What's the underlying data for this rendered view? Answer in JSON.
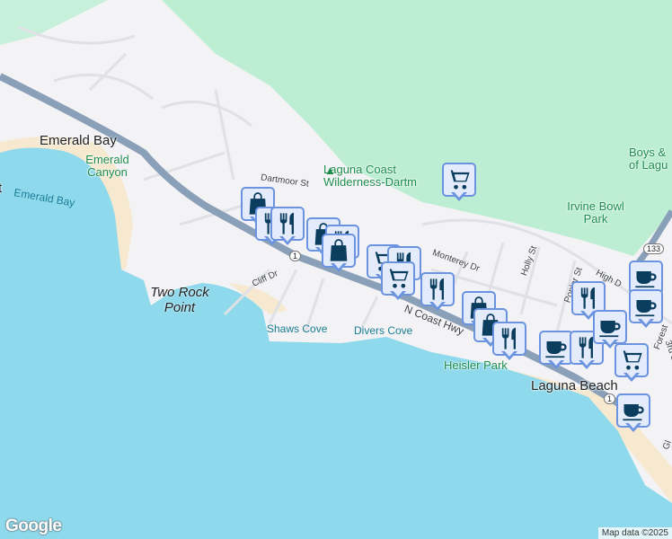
{
  "places": {
    "emerald_bay": "Emerald Bay",
    "emerald_canyon": "Emerald Canyon",
    "emerald_bay_water": "Emerald Bay",
    "two_rock_point": "Two Rock Point",
    "shaws_cove": "Shaws Cove",
    "divers_cove": "Divers Cove",
    "heisler_park": "Heisler Park",
    "laguna_beach": "Laguna Beach",
    "laguna_coast": "Laguna Coast Wilderness-Dartm",
    "irvine_bowl_park": "Irvine Bowl Park",
    "boys_girls": "Boys & of Lagu",
    "left_edge": "t"
  },
  "streets": {
    "dartmoor": "Dartmoor St",
    "cliff": "Cliff Dr",
    "monterey": "Monterey Dr",
    "holly": "Holly St",
    "poplar": "Poplar St",
    "high": "High D",
    "coast_hwy": "N Coast Hwy",
    "forest": "Forest",
    "third": "3rd S",
    "glenneyre": "Gl"
  },
  "shields": {
    "route1a": "1",
    "route1b": "1",
    "route133": "133"
  },
  "markers": [
    "shopping-bag",
    "restaurant",
    "restaurant",
    "shopping-bag",
    "restaurant",
    "shopping-bag",
    "grocery-cart",
    "restaurant",
    "grocery-cart",
    "restaurant",
    "grocery-cart",
    "shopping-bag",
    "shopping-bag",
    "restaurant",
    "coffee",
    "restaurant",
    "restaurant",
    "coffee",
    "coffee",
    "coffee",
    "grocery-cart",
    "coffee"
  ],
  "colors": {
    "water": "#8fd9ec",
    "land": "#f3f2f4",
    "park": "#bdeed3",
    "highway": "#8aa0b9",
    "marker_fill": "#e4ecfb",
    "marker_icon": "#0b3d5e"
  },
  "footer": {
    "attribution": "Map data ©2025",
    "logo": "Google"
  }
}
